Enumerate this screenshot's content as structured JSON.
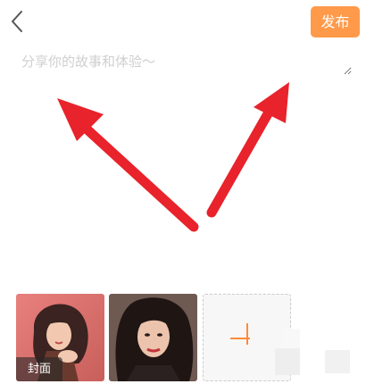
{
  "header": {
    "back_icon": "chevron-left-icon",
    "publish_label": "发布",
    "publish_color": "#ff9a4a"
  },
  "editor": {
    "placeholder": "分享你的故事和体验～",
    "value": ""
  },
  "overlay": {
    "arrow_color": "#e8232b"
  },
  "gallery": {
    "photos": [
      {
        "badge": "封面"
      },
      {
        "badge": ""
      }
    ],
    "add_icon": "plus-icon",
    "add_icon_color": "#ff8a3a"
  }
}
